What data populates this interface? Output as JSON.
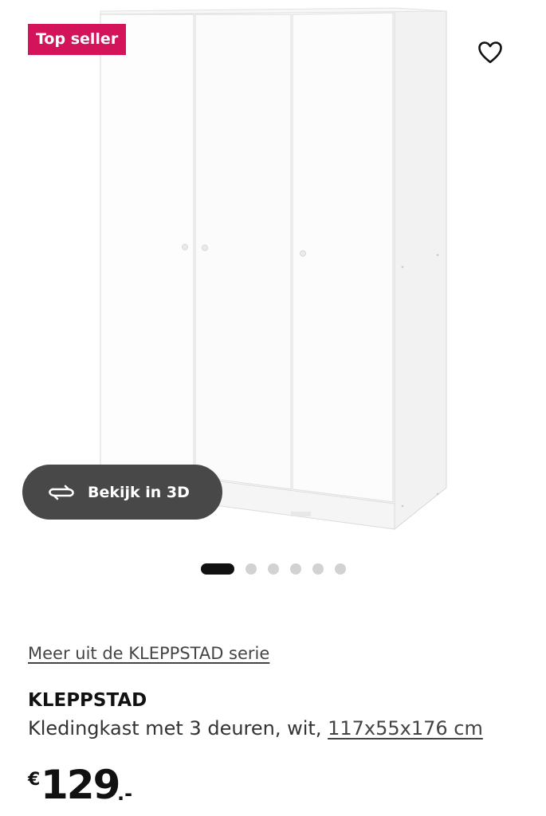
{
  "badge": {
    "label": "Top seller"
  },
  "favorite": {
    "icon": "heart-outline-icon"
  },
  "view3d": {
    "label": "Bekijk in 3D",
    "icon": "rotate-3d-icon"
  },
  "gallery": {
    "total": 6,
    "active_index": 0
  },
  "series_link": {
    "label": "Meer uit de KLEPPSTAD serie"
  },
  "product": {
    "name": "KLEPPSTAD",
    "description": "Kledingkast met 3 deuren, wit,",
    "dimensions": "117x55x176 cm"
  },
  "price": {
    "currency": "€",
    "amount": "129",
    "suffix": ".-"
  },
  "colors": {
    "badge": "#d4145a",
    "button_dark": "#484848",
    "dot_active": "#111111",
    "dot_inactive": "#d2d2d2"
  }
}
